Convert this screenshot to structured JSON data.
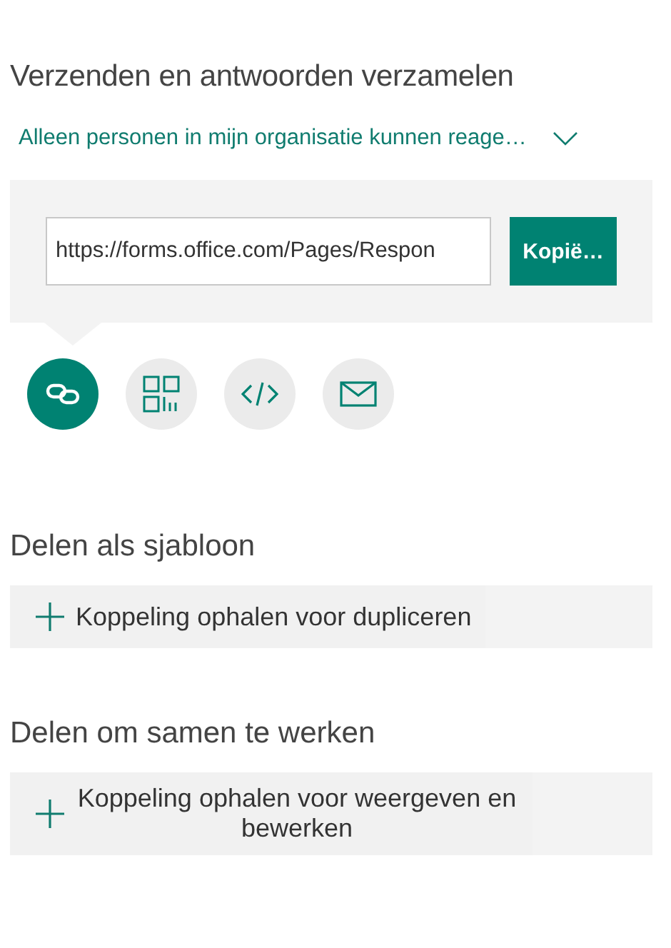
{
  "title": "Verzenden en antwoorden verzamelen",
  "audience": {
    "label": "Alleen personen in mijn organisatie kunnen reage…",
    "expanded": false
  },
  "link": {
    "value": "https://forms.office.com/Pages/Respon",
    "button": "Kopië…"
  },
  "share_methods": [
    {
      "kind": "link",
      "selected": true
    },
    {
      "kind": "qr",
      "selected": false
    },
    {
      "kind": "embed",
      "selected": false
    },
    {
      "kind": "email",
      "selected": false
    }
  ],
  "sections": [
    {
      "heading": "Delen als sjabloon",
      "action": "Koppeling ophalen voor dupliceren"
    },
    {
      "heading": "Delen om samen te werken",
      "action": "Koppeling ophalen voor weergeven en bewerken"
    }
  ]
}
